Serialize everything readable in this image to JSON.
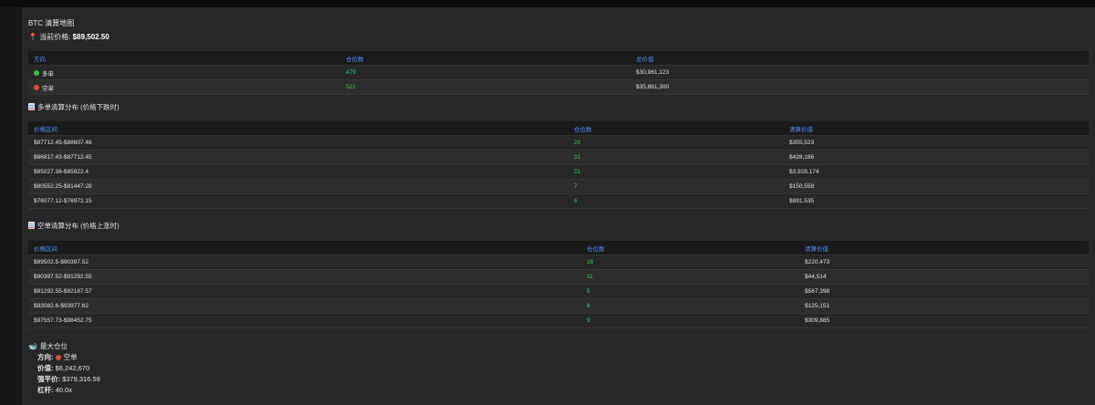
{
  "title": "BTC 清算地图",
  "current_price": {
    "label": "当前价格:",
    "value": "$89,502.50"
  },
  "summary": {
    "headers": [
      "方向",
      "仓位数",
      "总价值"
    ],
    "rows": [
      {
        "direction": "多单",
        "count": "479",
        "value": "$30,961,123",
        "color": "#3bc14a"
      },
      {
        "direction": "空单",
        "count": "521",
        "value": "$35,861,300",
        "color": "#e04a3b"
      }
    ]
  },
  "long_section": {
    "title": "多单清算分布 (价格下跌时)",
    "headers": [
      "价格区间",
      "仓位数",
      "清算价值"
    ],
    "rows": [
      {
        "range": "$87712.45-$88607.48",
        "count": "20",
        "value": "$355,523"
      },
      {
        "range": "$86817.43-$87712.45",
        "count": "31",
        "value": "$428,186"
      },
      {
        "range": "$85027.38-$85922.4",
        "count": "21",
        "value": "$3,928,174"
      },
      {
        "range": "$80552.25-$81447.28",
        "count": "7",
        "value": "$150,559"
      },
      {
        "range": "$76077.12-$76972.15",
        "count": "6",
        "value": "$891,535"
      }
    ]
  },
  "short_section": {
    "title": "空单清算分布 (价格上涨时)",
    "headers": [
      "价格区间",
      "仓位数",
      "清算价值"
    ],
    "rows": [
      {
        "range": "$89502.5-$90397.52",
        "count": "16",
        "value": "$220,473"
      },
      {
        "range": "$90397.52-$91292.55",
        "count": "11",
        "value": "$44,514"
      },
      {
        "range": "$91292.55-$92187.57",
        "count": "5",
        "value": "$567,398"
      },
      {
        "range": "$93082.6-$93977.62",
        "count": "8",
        "value": "$125,151"
      },
      {
        "range": "$97557.73-$98452.75",
        "count": "9",
        "value": "$309,885"
      }
    ]
  },
  "largest_position": {
    "title": "最大仓位",
    "direction_label": "方向:",
    "direction_value": "空单",
    "value_label": "价值:",
    "value": "$6,242,670",
    "liq_label": "强平价:",
    "liq_value": "$379,316.59",
    "leverage_label": "杠杆:",
    "leverage_value": "40.0x"
  },
  "icons": {
    "pin": "pushpin-icon",
    "long_dot": "green-circle-icon",
    "short_dot": "red-circle-icon",
    "long_section": "chart-down-icon",
    "short_section": "chart-up-icon",
    "largest": "whale-icon"
  }
}
